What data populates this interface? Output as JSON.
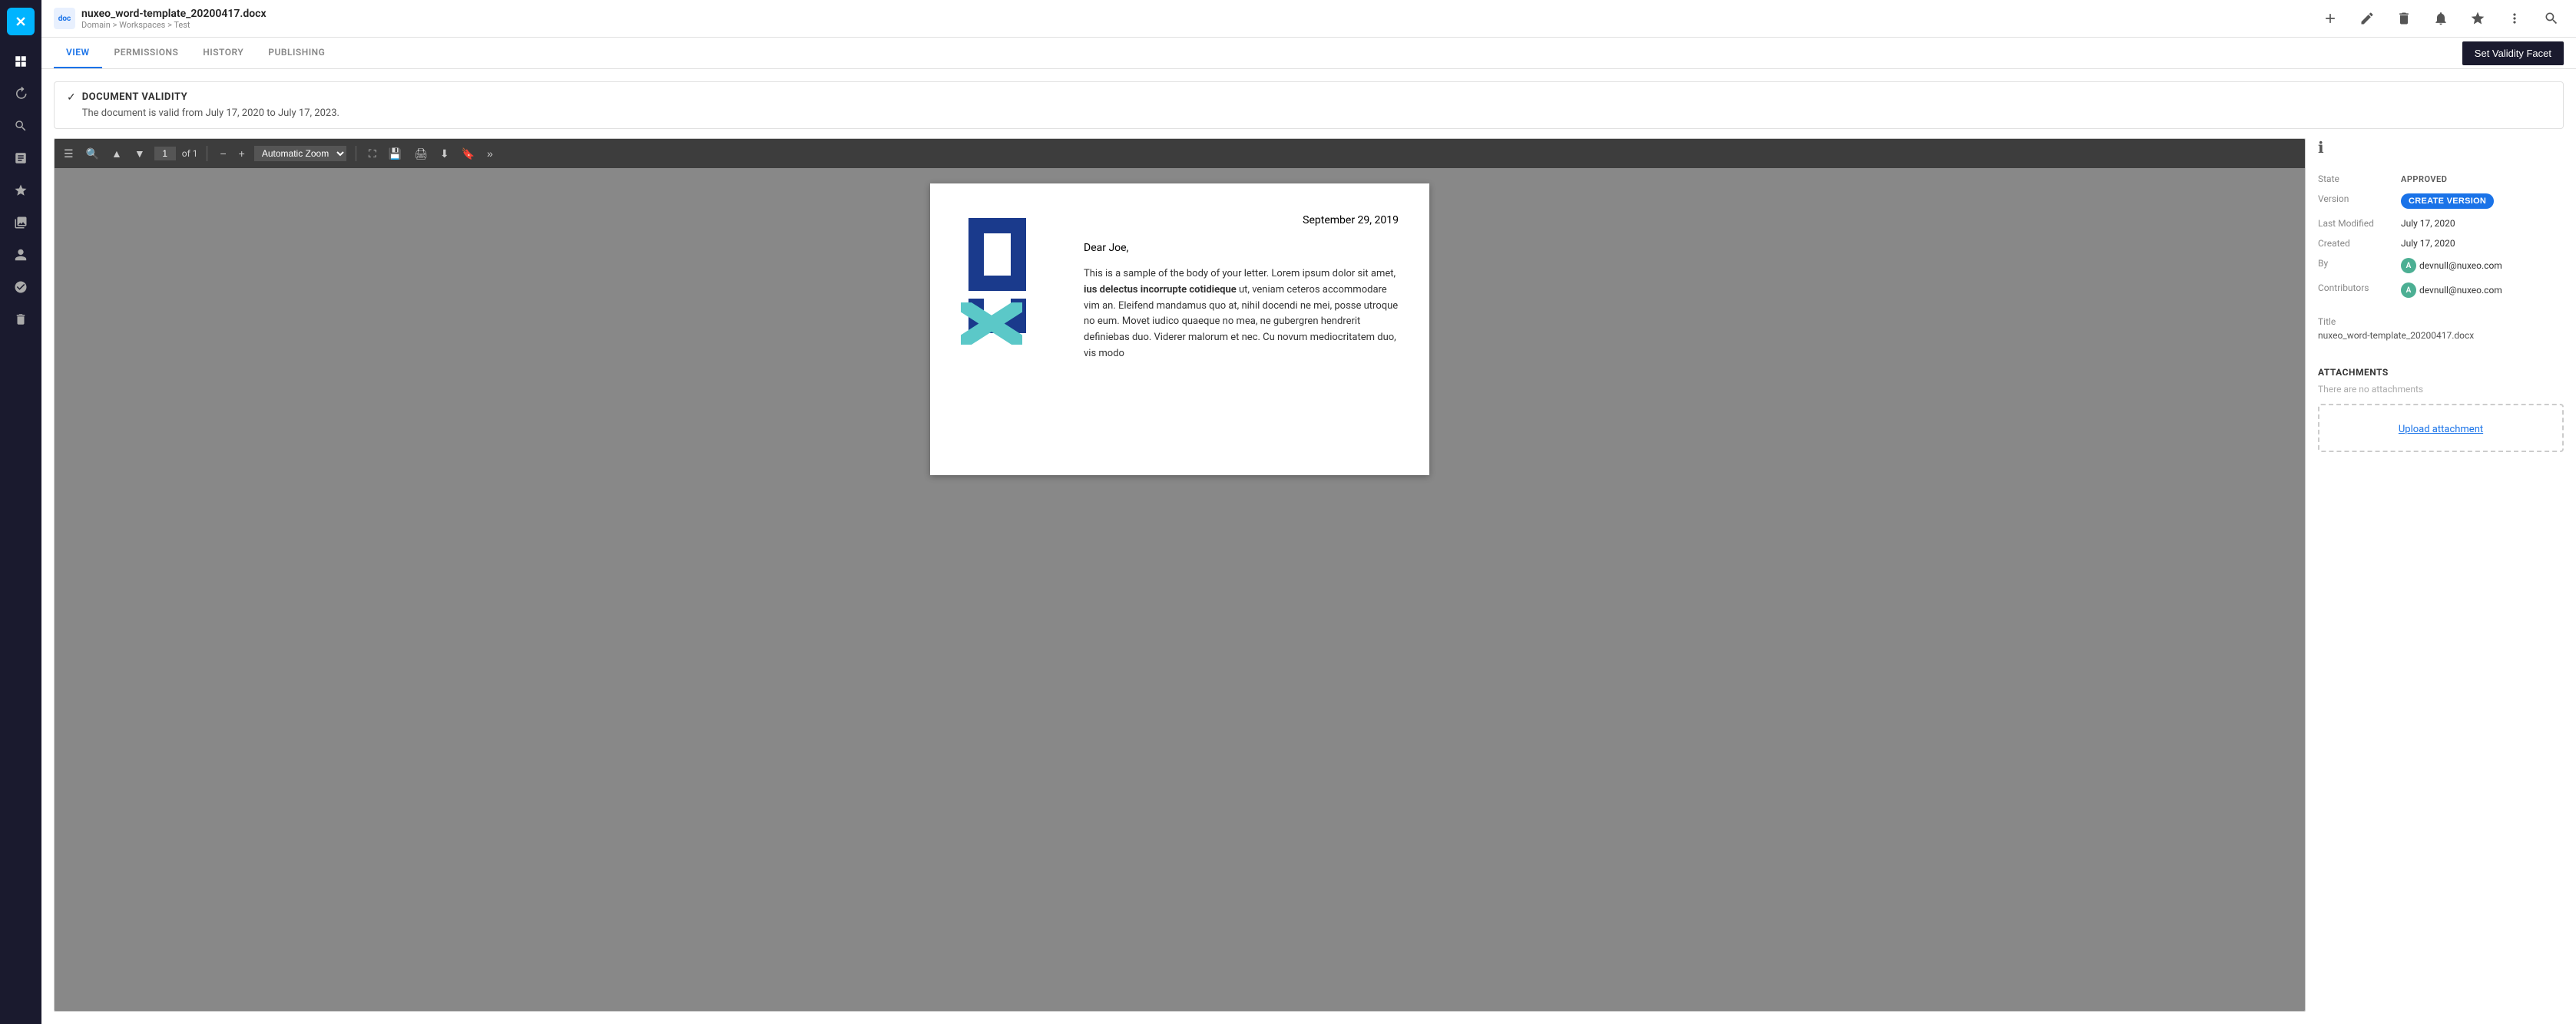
{
  "app": {
    "name": "Nuxeo"
  },
  "header": {
    "doc_icon": "DOC",
    "filename": "nuxeo_word-template_20200417.docx",
    "breadcrumb": "Domain > Workspaces > Test",
    "icons": [
      "add",
      "edit",
      "delete",
      "star-outline",
      "star",
      "more-vert",
      "search"
    ]
  },
  "tabs": {
    "items": [
      {
        "label": "VIEW",
        "active": true
      },
      {
        "label": "PERMISSIONS",
        "active": false
      },
      {
        "label": "HISTORY",
        "active": false
      },
      {
        "label": "PUBLISHING",
        "active": false
      }
    ],
    "set_validity_label": "Set Validity Facet"
  },
  "validity": {
    "title": "DOCUMENT VALIDITY",
    "description": "The document is valid from July 17, 2020 to July 17, 2023."
  },
  "pdf_viewer": {
    "page_current": "1",
    "page_total": "of 1",
    "zoom_option": "Automatic Zoom",
    "letter_date": "September 29, 2019",
    "letter_greeting": "Dear Joe,",
    "letter_body": "This is a sample of the body of your letter. Lorem ipsum dolor sit amet, ius delectus incorrupte cotidieque ut, veniam ceteros accommodare vim an. Eleifend mandamus quo at, nihil docendi ne mei, posse utroque no eum. Movet iudico quaeque no mea, ne gubergren hendrerit definiebas duo. Viderer malorum et nec. Cu novum mediocritatem duo, vis modo"
  },
  "metadata": {
    "info_icon": "ℹ",
    "state_label": "State",
    "state_value": "APPROVED",
    "version_label": "Version",
    "version_btn": "CREATE VERSION",
    "last_modified_label": "Last Modified",
    "last_modified_value": "July 17, 2020",
    "created_label": "Created",
    "created_value": "July 17, 2020",
    "by_label": "By",
    "by_email": "devnull@nuxeo.com",
    "contributors_label": "Contributors",
    "contributors_email": "devnull@nuxeo.com",
    "title_label": "Title",
    "title_value": "nuxeo_word-template_20200417.docx"
  },
  "attachments": {
    "title": "ATTACHMENTS",
    "no_attachments": "There are no attachments",
    "upload_label": "Upload attachment"
  },
  "sidebar": {
    "items": [
      {
        "icon": "grid",
        "label": "Dashboard"
      },
      {
        "icon": "history",
        "label": "Recent"
      },
      {
        "icon": "search",
        "label": "Search"
      },
      {
        "icon": "inbox",
        "label": "Tasks"
      },
      {
        "icon": "star",
        "label": "Favorites"
      },
      {
        "icon": "collections",
        "label": "Collections"
      },
      {
        "icon": "person",
        "label": "Profile"
      },
      {
        "icon": "admin",
        "label": "Administration"
      },
      {
        "icon": "trash",
        "label": "Trash"
      }
    ]
  }
}
